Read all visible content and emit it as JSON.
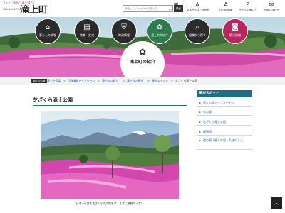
{
  "header": {
    "logo_tagline": "ちょっと素敵に“滝上”暮らし",
    "logo_sub": "TAKINOUE TOWN",
    "logo_name": "滝上町",
    "search_placeholder": "検索したいキーワードを入力",
    "search_button": "検索",
    "utilities": [
      {
        "icon": "sitemap-icon",
        "glyph": "⊞",
        "label": "サイトマップ"
      },
      {
        "icon": "font-size-icon",
        "glyph": "A",
        "label": "文字サイズ・配色色"
      },
      {
        "icon": "language-icon",
        "glyph": "A",
        "label": "Language"
      },
      {
        "icon": "usage-icon",
        "glyph": "?",
        "label": "サイトの使い方"
      },
      {
        "icon": "contact-icon",
        "glyph": "✉",
        "label": "お問い合わせ"
      }
    ]
  },
  "nav": {
    "items": [
      {
        "icon": "house-icon",
        "glyph": "⌂",
        "label": "暮らしの情報"
      },
      {
        "icon": "book-icon",
        "glyph": "▤",
        "label": "教育・文化"
      },
      {
        "icon": "townhall-icon",
        "glyph": "⛨",
        "label": "町政情報"
      },
      {
        "icon": "flower-icon",
        "glyph": "✿",
        "label": "滝上町の紹介"
      },
      {
        "icon": "search-icon",
        "glyph": "⌕",
        "label": "組織から探す"
      },
      {
        "icon": "camera-icon",
        "glyph": "◙",
        "label": "観光情報"
      }
    ]
  },
  "hero": {
    "section_icon": "flower-icon",
    "section_glyph": "✿",
    "section_label": "滝上町の紹介"
  },
  "breadcrumb": {
    "tag": "現在の位置",
    "items": [
      "滝上町役場",
      "行政情報トップページ",
      "滝上町の紹介",
      "滝上町の観光",
      "観光スポット",
      "芝ざくら滝上公園"
    ]
  },
  "main": {
    "title": "芝ざくら滝上公園",
    "caption": "日本一を誇る芝ざくらの大群落は、まさに感動の一言！"
  },
  "sidebar": {
    "heading": "観光スポット",
    "items": [
      "香りの里ハーブガーデン",
      "杉の都",
      "芝ざくら滝上公園",
      "陽殖館",
      "道の駅「香りの里・たきのうえ」"
    ]
  },
  "colors": {
    "nav_active": "#2f7a4e",
    "nav_tourism": "#b7265f",
    "sidebar_head": "#1d6d86",
    "link": "#1a5ea8"
  }
}
